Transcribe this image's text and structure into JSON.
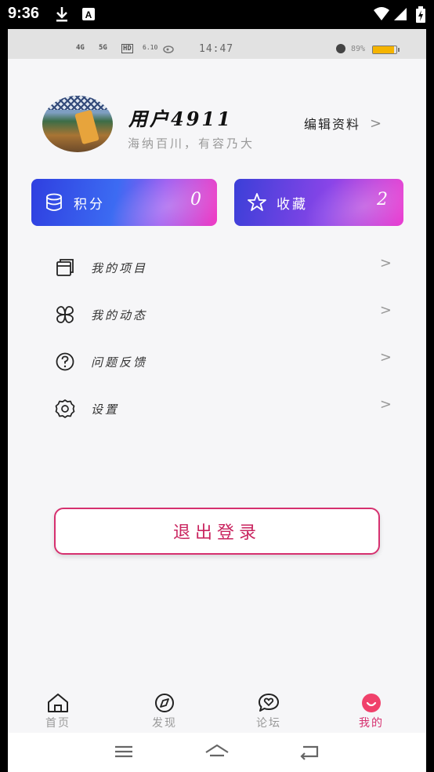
{
  "system_bar": {
    "time": "9:36",
    "icons": [
      "download-icon",
      "app-a-icon",
      "wifi-icon",
      "signal-icon",
      "battery-icon"
    ],
    "icon_color": "#ffffff"
  },
  "inner_status": {
    "signal_labels": [
      "4G",
      "5G",
      "HD"
    ],
    "speed": "6.10",
    "time": "14:47",
    "battery_pct": "89%",
    "battery_level": 0.89,
    "battery_color": "#f5b400"
  },
  "profile": {
    "username": "用户4911",
    "slogan": "海纳百川，有容乃大",
    "edit_label": "编辑资料",
    "chevron": ">"
  },
  "stats": [
    {
      "label": "积分",
      "value": "0",
      "icon": "database-icon"
    },
    {
      "label": "收藏",
      "value": "2",
      "icon": "star-icon"
    }
  ],
  "menu": [
    {
      "label": "我的项目",
      "icon": "projects-icon"
    },
    {
      "label": "我的动态",
      "icon": "clover-icon"
    },
    {
      "label": "问题反馈",
      "icon": "question-icon"
    },
    {
      "label": "设置",
      "icon": "gear-icon"
    }
  ],
  "menu_chevron": ">",
  "logout_label": "退出登录",
  "tabs": [
    {
      "label": "首页",
      "icon": "home-icon",
      "active": false
    },
    {
      "label": "发现",
      "icon": "compass-icon",
      "active": false
    },
    {
      "label": "论坛",
      "icon": "chat-heart-icon",
      "active": false
    },
    {
      "label": "我的",
      "icon": "smile-icon",
      "active": true
    }
  ],
  "colors": {
    "accent": "#d6306f",
    "points_gradient": [
      "#2f3fe0",
      "#f03cc4"
    ],
    "fav_gradient": [
      "#3b3fd8",
      "#ea3ad0"
    ],
    "background": "#f6f6f8"
  },
  "nav_buttons": [
    "menu-icon",
    "home-outline-icon",
    "back-icon"
  ]
}
